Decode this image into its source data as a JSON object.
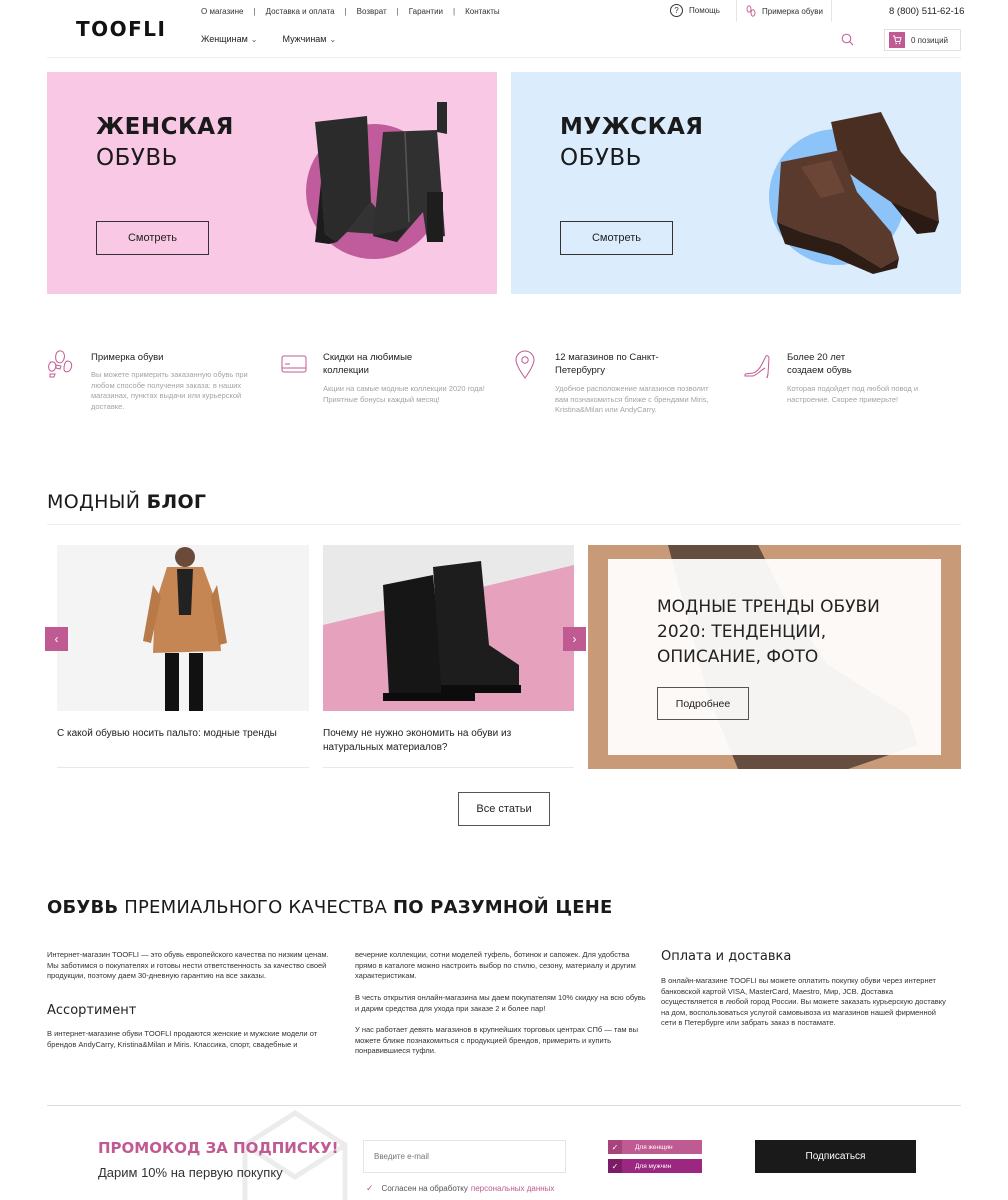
{
  "brand": {
    "logo": "TOOFLI",
    "accent": "#c05a93"
  },
  "header": {
    "top_links": [
      "О магазине",
      "Доставка и оплата",
      "Возврат",
      "Гарантии",
      "Контакты"
    ],
    "help": "Помощь",
    "fitting": "Примерка обуви",
    "phone": "8 (800) 511-62-16",
    "nav": [
      "Женщинам",
      "Мужчинам"
    ],
    "cart": "0 позиций"
  },
  "hero": {
    "women": {
      "title_bold": "ЖЕНСКАЯ",
      "title_light": "ОБУВЬ",
      "button": "Смотреть",
      "bg": "#f8c8e4",
      "circle": "#c15c9c"
    },
    "men": {
      "title_bold": "МУЖСКАЯ",
      "title_light": "ОБУВЬ",
      "button": "Смотреть",
      "bg": "#dbecfd",
      "circle": "#8cc4f9"
    }
  },
  "features": [
    {
      "icon": "footprints-icon",
      "title": "Примерка обуви",
      "desc": "Вы можете примерить заказанную обувь при любом способе получения заказа: в наших магазинах, пунктах выдачи или курьерской доставке."
    },
    {
      "icon": "discount-card-icon",
      "title": "Скидки на любимые коллекции",
      "desc": "Акции на самые модные коллекции 2020 года! Приятные бонусы каждый месяц!"
    },
    {
      "icon": "location-pin-icon",
      "title": "12 магазинов по Санкт-Петербургу",
      "desc": "Удобное расположение магазинов позволит вам познакомиться ближе с брендами Miris, Kristina&Milan или AndyCarry."
    },
    {
      "icon": "high-heel-icon",
      "title": "Более 20 лет создаем обувь",
      "desc": "Которая подойдет под любой повод и настроение. Скорее примерьте!"
    }
  ],
  "blog": {
    "title_light": "МОДНЫЙ ",
    "title_bold": "БЛОГ",
    "cards": [
      {
        "caption": "С какой обувью носить пальто: модные тренды"
      },
      {
        "caption": "Почему не нужно экономить на обуви из натуральных материалов?"
      }
    ],
    "featured": {
      "title": "МОДНЫЕ ТРЕНДЫ ОБУВИ 2020: ТЕНДЕНЦИИ, ОПИСАНИЕ, ФОТО",
      "button": "Подробнее"
    },
    "all_button": "Все статьи"
  },
  "premium": {
    "title_b1": "ОБУВЬ",
    "title_mid": " ПРЕМИАЛЬНОГО КАЧЕСТВА ",
    "title_b2": "ПО РАЗУМНОЙ ЦЕНЕ",
    "col1_p1": "Интернет-магазин TOOFLI — это обувь европейского качества по низким ценам. Мы заботимся о покупателях и готовы нести ответственность за качество своей продукции, поэтому даем 30-дневную гарантию на все заказы.",
    "col1_h": "Ассортимент",
    "col1_p2": "В интернет-магазине обуви TOOFLI продаются женские и мужские модели от брендов AndyCarry, Kristina&Milan и Miris. Классика, спорт, свадебные и",
    "col2_p1": "вечерние коллекции, сотни моделей туфель, ботинок и сапожек. Для удобства прямо в каталоге можно настроить выбор по стилю, сезону, материалу и другим характеристикам.",
    "col2_p2": "В честь открытия онлайн-магазина мы даем покупателям 10% скидку на всю обувь и дарим средства для ухода при заказе 2 и более пар!",
    "col2_p3": "У нас работает девять магазинов в крупнейших торговых центрах СПб — там вы можете ближе познакомиться с продукцией брендов, примерить и купить понравившиеся туфли.",
    "col3_h": "Оплата и доставка",
    "col3_p": "В онлайн-магазине TOOFLI вы можете оплатить покупку обуви через интернет банковской картой VISA, MasterCard, Maestro, Мир, JCB. Доставка осуществляется в любой город России. Вы можете заказать курьерскую доставку на дом, воспользоваться услугой самовывоза из магазинов нашей фирменной сети в Петербурге или забрать заказ в постамате."
  },
  "subscribe": {
    "title": "ПРОМОКОД ЗА ПОДПИСКУ!",
    "subtitle": "Дарим 10% на первую покупку",
    "email_placeholder": "Введите e-mail",
    "for_women": "Для женщин",
    "for_men": "Для мужчин",
    "button": "Подписаться",
    "agree": "Согласен на обработку",
    "agree_link": "персональных данных"
  }
}
